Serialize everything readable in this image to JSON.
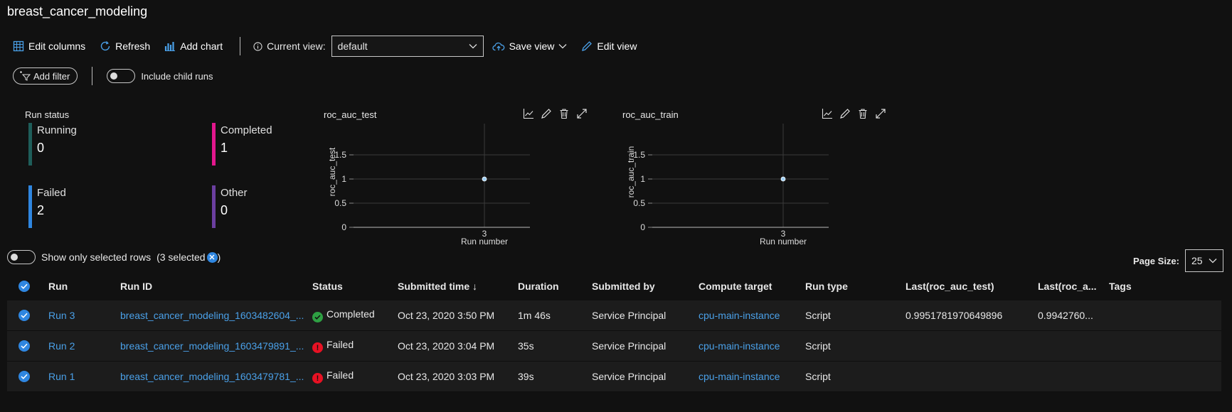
{
  "page": {
    "title": "breast_cancer_modeling"
  },
  "toolbar": {
    "edit_columns": "Edit columns",
    "refresh": "Refresh",
    "add_chart": "Add chart",
    "current_view_label": "Current view:",
    "current_view_value": "default",
    "save_view": "Save view",
    "edit_view": "Edit view"
  },
  "filters": {
    "add_filter": "Add filter",
    "include_child_runs": "Include child runs"
  },
  "run_status": {
    "title": "Run status",
    "items": [
      {
        "label": "Running",
        "value": "0",
        "color": "#1e5e5a"
      },
      {
        "label": "Completed",
        "value": "1",
        "color": "#e3178d"
      },
      {
        "label": "Failed",
        "value": "2",
        "color": "#2f86e0"
      },
      {
        "label": "Other",
        "value": "0",
        "color": "#6b3fa0"
      }
    ]
  },
  "chart_data": [
    {
      "type": "scatter",
      "title": "roc_auc_test",
      "xlabel": "Run number",
      "ylabel": "roc_auc_test",
      "x_ticks": [
        "3"
      ],
      "y_ticks": [
        "0",
        "0.5",
        "1",
        "1.5"
      ],
      "ylim": [
        0,
        2
      ],
      "grid": true,
      "points": [
        {
          "x": 3,
          "y": 1
        }
      ],
      "point_color": "#9fd0f5"
    },
    {
      "type": "scatter",
      "title": "roc_auc_train",
      "xlabel": "Run number",
      "ylabel": "roc_auc_train",
      "x_ticks": [
        "3"
      ],
      "y_ticks": [
        "0",
        "0.5",
        "1",
        "1.5"
      ],
      "ylim": [
        0,
        2
      ],
      "grid": true,
      "points": [
        {
          "x": 3,
          "y": 1
        }
      ],
      "point_color": "#9fd0f5"
    }
  ],
  "selection": {
    "show_only_selected": "Show only selected rows",
    "selected_count": "(3 selected"
  },
  "pager": {
    "label": "Page Size:",
    "value": "25"
  },
  "table": {
    "columns": [
      "Run",
      "Run ID",
      "Status",
      "Submitted time ↓",
      "Duration",
      "Submitted by",
      "Compute target",
      "Run type",
      "Last(roc_auc_test)",
      "Last(roc_a...",
      "Tags"
    ],
    "rows": [
      {
        "run": "Run 3",
        "run_id": "breast_cancer_modeling_1603482604_...",
        "status": "Completed",
        "status_color": "#2ea043",
        "submitted": "Oct 23, 2020 3:50 PM",
        "duration": "1m 46s",
        "by": "Service Principal",
        "compute": "cpu-main-instance",
        "type": "Script",
        "last_test": "0.9951781970649896",
        "last_train": "0.9942760...",
        "tags": ""
      },
      {
        "run": "Run 2",
        "run_id": "breast_cancer_modeling_1603479891_...",
        "status": "Failed",
        "status_color": "#e81123",
        "submitted": "Oct 23, 2020 3:04 PM",
        "duration": "35s",
        "by": "Service Principal",
        "compute": "cpu-main-instance",
        "type": "Script",
        "last_test": "",
        "last_train": "",
        "tags": ""
      },
      {
        "run": "Run 1",
        "run_id": "breast_cancer_modeling_1603479781_...",
        "status": "Failed",
        "status_color": "#e81123",
        "submitted": "Oct 23, 2020 3:03 PM",
        "duration": "39s",
        "by": "Service Principal",
        "compute": "cpu-main-instance",
        "type": "Script",
        "last_test": "",
        "last_train": "",
        "tags": ""
      }
    ]
  }
}
